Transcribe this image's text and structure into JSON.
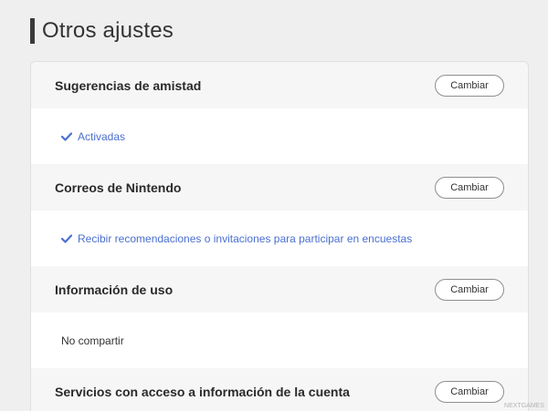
{
  "page": {
    "title": "Otros ajustes"
  },
  "sections": [
    {
      "title": "Sugerencias de amistad",
      "button_label": "Cambiar",
      "value": "Activadas",
      "checked": true
    },
    {
      "title": "Correos de Nintendo",
      "button_label": "Cambiar",
      "value": "Recibir recomendaciones o invitaciones para participar en encuestas",
      "checked": true
    },
    {
      "title": "Información de uso",
      "button_label": "Cambiar",
      "value": "No compartir",
      "checked": false
    },
    {
      "title": "Servicios con acceso a información de la cuenta",
      "button_label": "Cambiar"
    }
  ],
  "watermark": "NEXTGAMES",
  "colors": {
    "accent_link": "#4a6fd1",
    "header_bar": "#3a3a3a",
    "background": "#efefef"
  },
  "icons": {
    "check": "check-icon"
  }
}
